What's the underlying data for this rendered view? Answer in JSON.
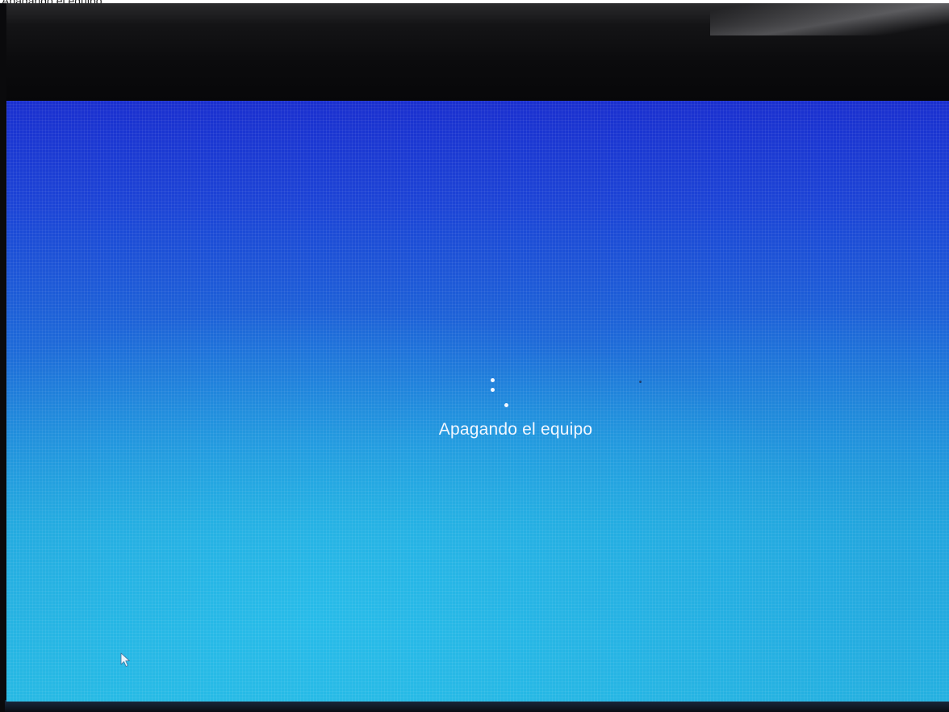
{
  "photo_caption": "Apagando el equipo",
  "screen": {
    "status_text": "Apagando el equipo",
    "background_colors": {
      "top": "#1a2fcf",
      "middle": "#1e70d8",
      "bottom": "#26b6df"
    }
  },
  "spinner": {
    "icon": "loading-dots-icon",
    "dot_color": "#f3f8ff"
  },
  "cursor": {
    "icon": "mouse-pointer-icon"
  }
}
